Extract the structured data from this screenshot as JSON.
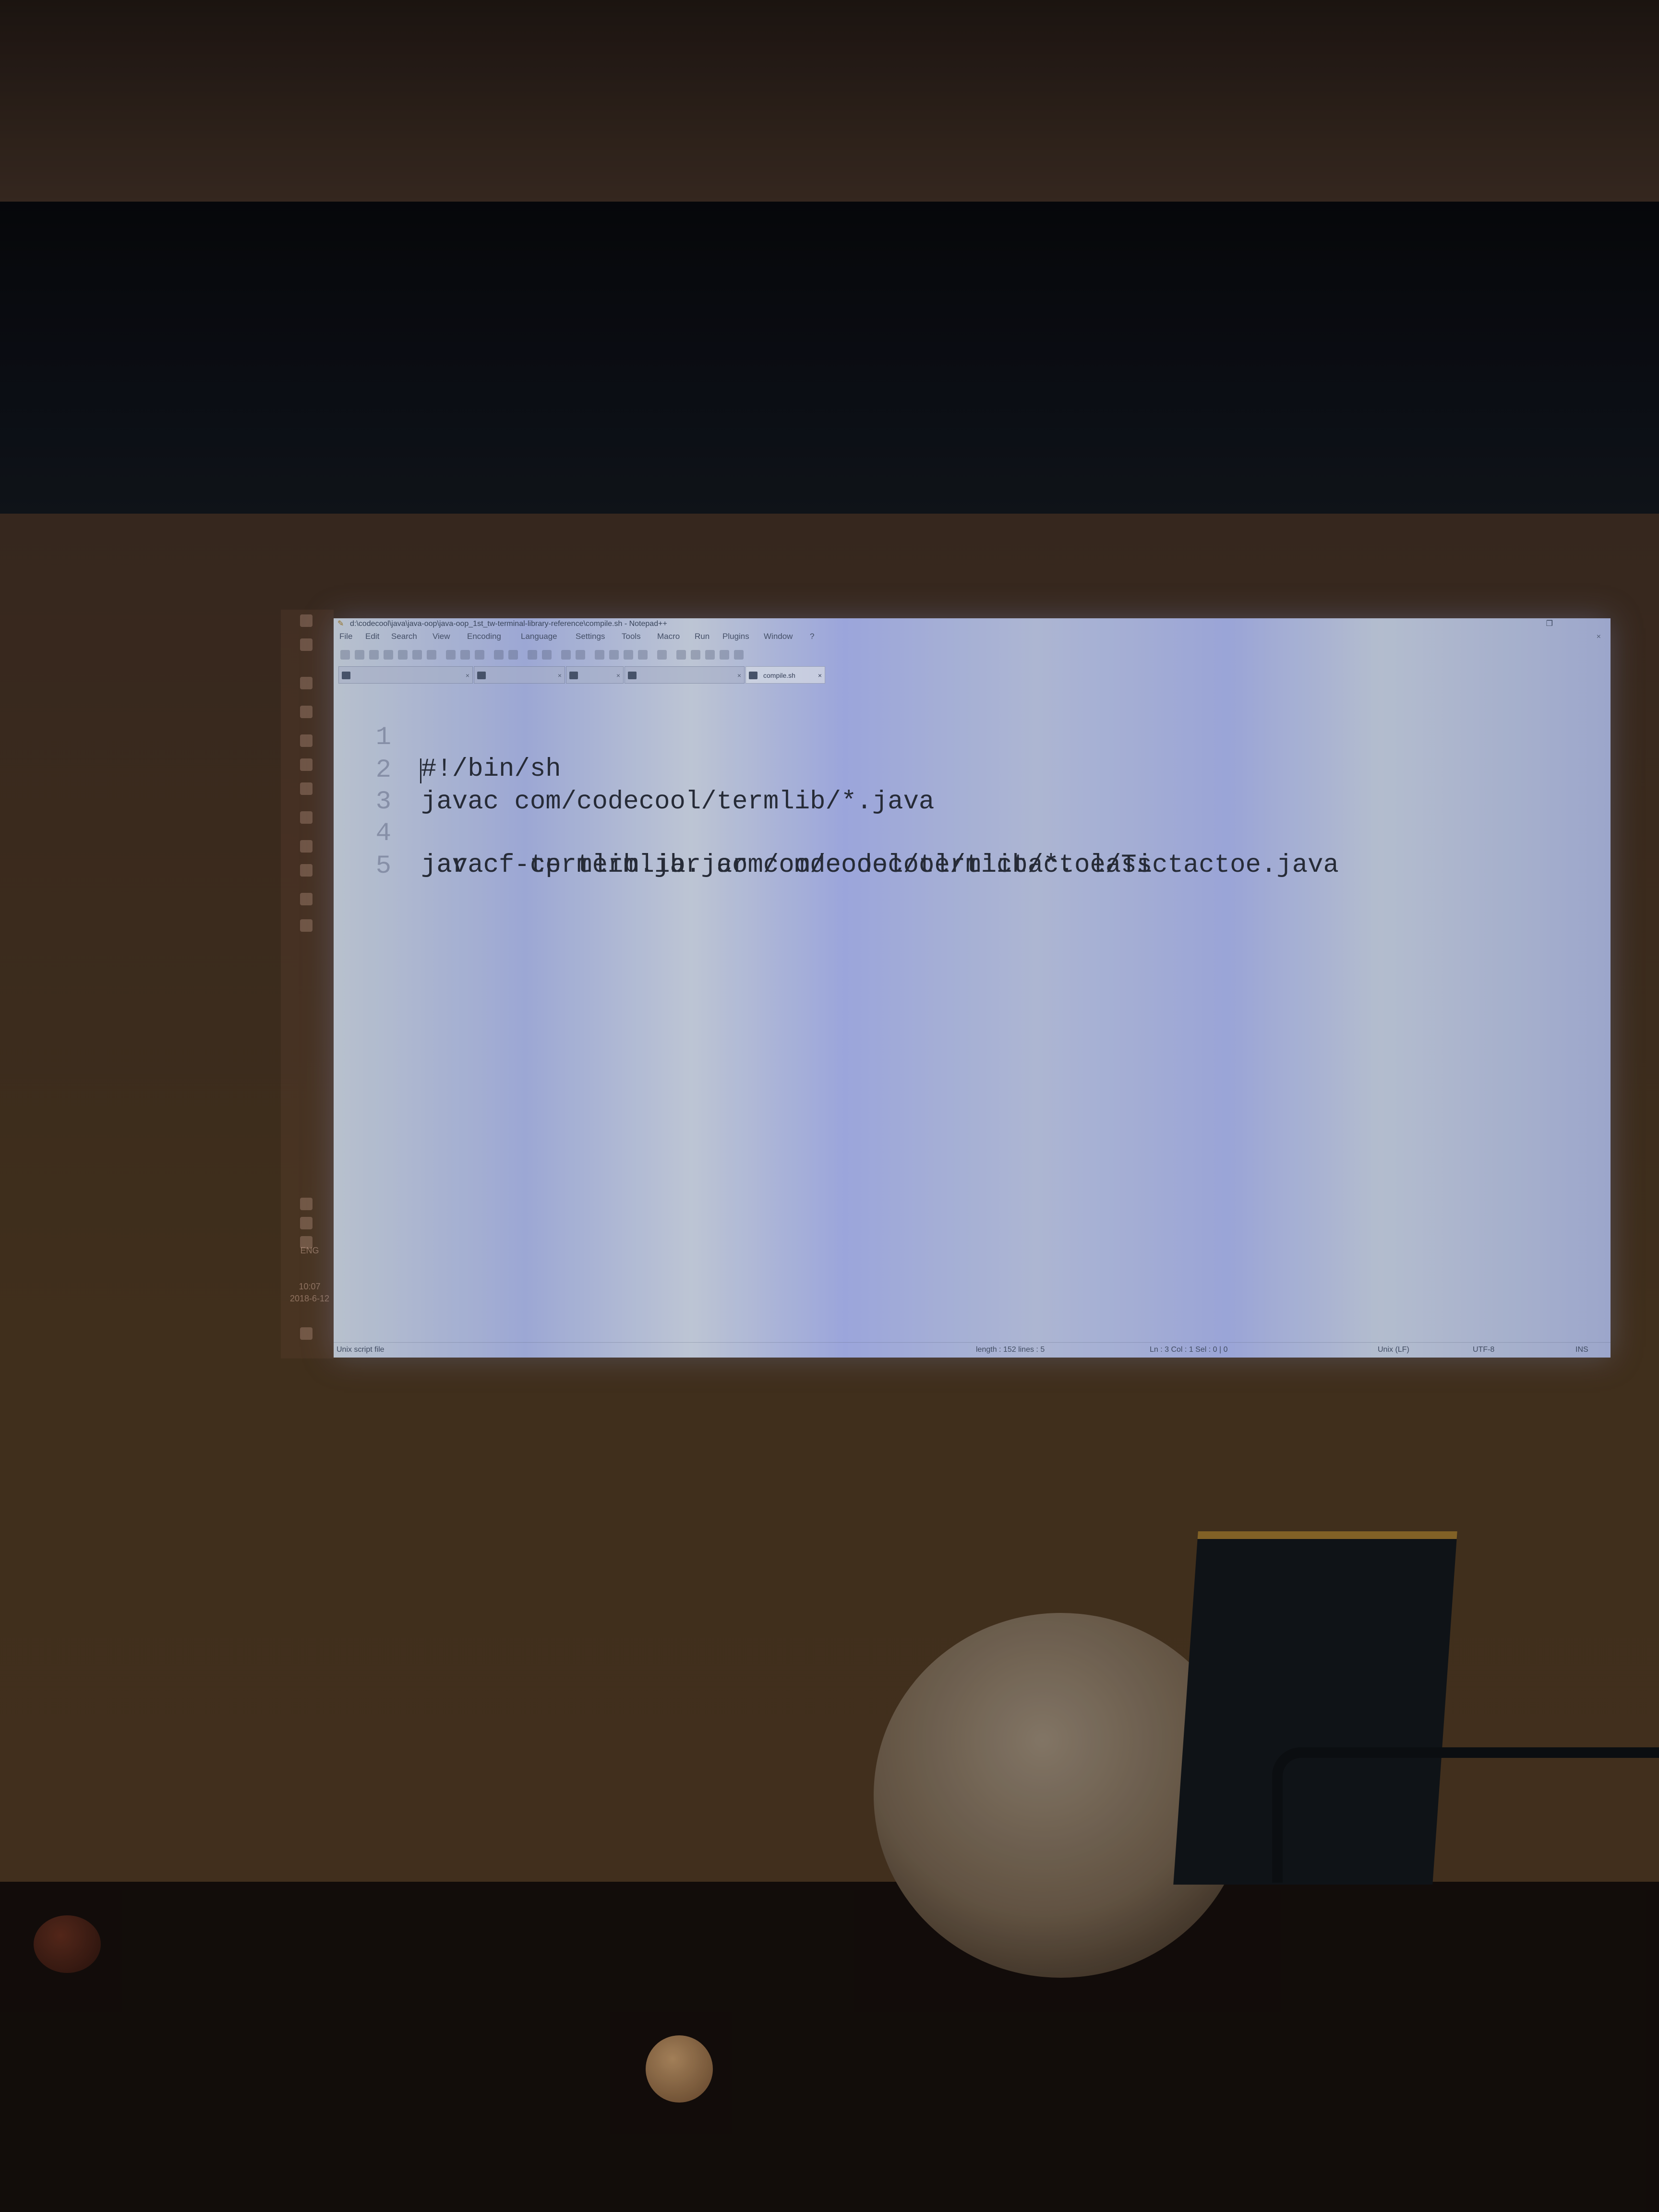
{
  "window": {
    "title": "d:\\codecool\\java\\java-oop\\java-oop_1st_tw-terminal-library-reference\\compile.sh - Notepad++"
  },
  "menu": [
    "File",
    "Edit",
    "Search",
    "View",
    "Encoding",
    "Language",
    "Settings",
    "Tools",
    "Macro",
    "Run",
    "Plugins",
    "Window",
    "?"
  ],
  "tabs": [
    {
      "label": "",
      "active": false
    },
    {
      "label": "",
      "active": false
    },
    {
      "label": "",
      "active": false
    },
    {
      "label": "",
      "active": false
    },
    {
      "label": "compile.sh",
      "active": true
    }
  ],
  "editor": {
    "lines": [
      {
        "number": "1",
        "text": "#!/bin/sh"
      },
      {
        "number": "2",
        "text": "javac com/codecool/termlib/*.java"
      },
      {
        "number": "3",
        "text": "jar cf termlib.jar com/codecool/termlib/*.class"
      },
      {
        "number": "4",
        "text": "javac -cp termlib.jar com/codecool/tictactoe/Tictactoe.java"
      },
      {
        "number": "5",
        "text": ""
      }
    ]
  },
  "statusbar": {
    "file_type": "Unix script file",
    "length": "length : 152    lines : 5",
    "position": "Ln : 3    Col : 1    Sel : 0 | 0",
    "eol": "Unix (LF)",
    "encoding": "UTF-8",
    "mode": "INS"
  },
  "taskbar": {
    "language": "ENG",
    "time": "10:07",
    "date": "2018-6-12"
  },
  "colors": {
    "code_text": "#2a2f3c",
    "line_numbers": "#6a7492",
    "notepad_icon": "#a07a2a"
  }
}
